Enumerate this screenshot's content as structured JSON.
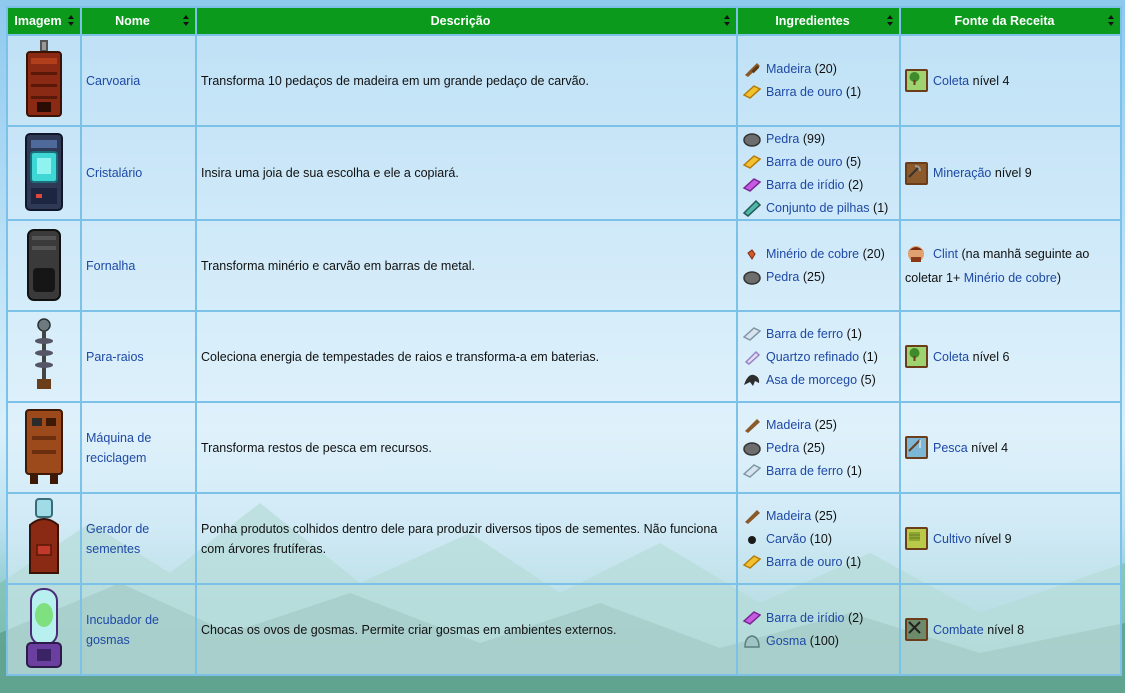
{
  "colors": {
    "header_bg": "#0b9a1b",
    "link": "#1e49a5",
    "border": "#7cc2e8"
  },
  "headers": [
    "Imagem",
    "Nome",
    "Descrição",
    "Ingredientes",
    "Fonte da Receita"
  ],
  "rows": [
    {
      "icon": "carvoaria-machine-icon",
      "name": "Carvoaria",
      "description": "Transforma 10 pedaços de madeira em um grande pedaço de carvão.",
      "ingredients": [
        {
          "icon": "wood-icon",
          "name": "Madeira",
          "qty": "(20)"
        },
        {
          "icon": "gold-bar-icon",
          "name": "Barra de ouro",
          "qty": "(1)"
        }
      ],
      "source": {
        "icon": "foraging-skill-icon",
        "link": "Coleta",
        "text": "nível 4"
      }
    },
    {
      "icon": "cristalario-machine-icon",
      "name": "Cristalário",
      "description": "Insira uma joia de sua escolha e ele a copiará.",
      "ingredients": [
        {
          "icon": "stone-icon",
          "name": "Pedra",
          "qty": "(99)"
        },
        {
          "icon": "gold-bar-icon",
          "name": "Barra de ouro",
          "qty": "(5)"
        },
        {
          "icon": "iridium-bar-icon",
          "name": "Barra de irídio",
          "qty": "(2)"
        },
        {
          "icon": "battery-pack-icon",
          "name": "Conjunto de pilhas",
          "qty": "(1)"
        }
      ],
      "source": {
        "icon": "mining-skill-icon",
        "link": "Mineração",
        "text": "nível 9"
      }
    },
    {
      "icon": "fornalha-machine-icon",
      "name": "Fornalha",
      "description": "Transforma minério e carvão em barras de metal.",
      "ingredients": [
        {
          "icon": "copper-ore-icon",
          "name": "Minério de cobre",
          "qty": "(20)"
        },
        {
          "icon": "stone-icon",
          "name": "Pedra",
          "qty": "(25)"
        }
      ],
      "source": {
        "icon": "clint-portrait-icon",
        "link": "Clint",
        "text": "(na manhã seguinte ao",
        "text2": "coletar 1+",
        "link2": "Minério de cobre",
        "text3": ")"
      }
    },
    {
      "icon": "para-raios-machine-icon",
      "name": "Para-raios",
      "description": "Coleciona energia de tempestades de raios e transforma-a em baterias.",
      "ingredients": [
        {
          "icon": "iron-bar-icon",
          "name": "Barra de ferro",
          "qty": "(1)"
        },
        {
          "icon": "refined-quartz-icon",
          "name": "Quartzo refinado",
          "qty": "(1)"
        },
        {
          "icon": "bat-wing-icon",
          "name": "Asa de morcego",
          "qty": "(5)"
        }
      ],
      "source": {
        "icon": "foraging-skill-icon",
        "link": "Coleta",
        "text": "nível 6"
      }
    },
    {
      "icon": "recycling-machine-icon",
      "name": "Máquina de reciclagem",
      "description": "Transforma restos de pesca em recursos.",
      "ingredients": [
        {
          "icon": "wood-icon",
          "name": "Madeira",
          "qty": "(25)"
        },
        {
          "icon": "stone-icon",
          "name": "Pedra",
          "qty": "(25)"
        },
        {
          "icon": "iron-bar-icon",
          "name": "Barra de ferro",
          "qty": "(1)"
        }
      ],
      "source": {
        "icon": "fishing-skill-icon",
        "link": "Pesca",
        "text": "nível 4"
      }
    },
    {
      "icon": "seed-maker-machine-icon",
      "name": "Gerador de sementes",
      "description": "Ponha produtos colhidos dentro dele para produzir diversos tipos de sementes. Não funciona com árvores frutíferas.",
      "ingredients": [
        {
          "icon": "wood-icon",
          "name": "Madeira",
          "qty": "(25)"
        },
        {
          "icon": "coal-icon",
          "name": "Carvão",
          "qty": "(10)"
        },
        {
          "icon": "gold-bar-icon",
          "name": "Barra de ouro",
          "qty": "(1)"
        }
      ],
      "source": {
        "icon": "farming-skill-icon",
        "link": "Cultivo",
        "text": "nível 9"
      }
    },
    {
      "icon": "slime-incubator-machine-icon",
      "name": "Incubador de gosmas",
      "description": "Chocas os ovos de gosmas. Permite criar gosmas em ambientes externos.",
      "ingredients": [
        {
          "icon": "iridium-bar-icon",
          "name": "Barra de irídio",
          "qty": "(2)"
        },
        {
          "icon": "slime-icon",
          "name": "Gosma",
          "qty": "(100)"
        }
      ],
      "source": {
        "icon": "combat-skill-icon",
        "link": "Combate",
        "text": "nível 8"
      }
    }
  ]
}
